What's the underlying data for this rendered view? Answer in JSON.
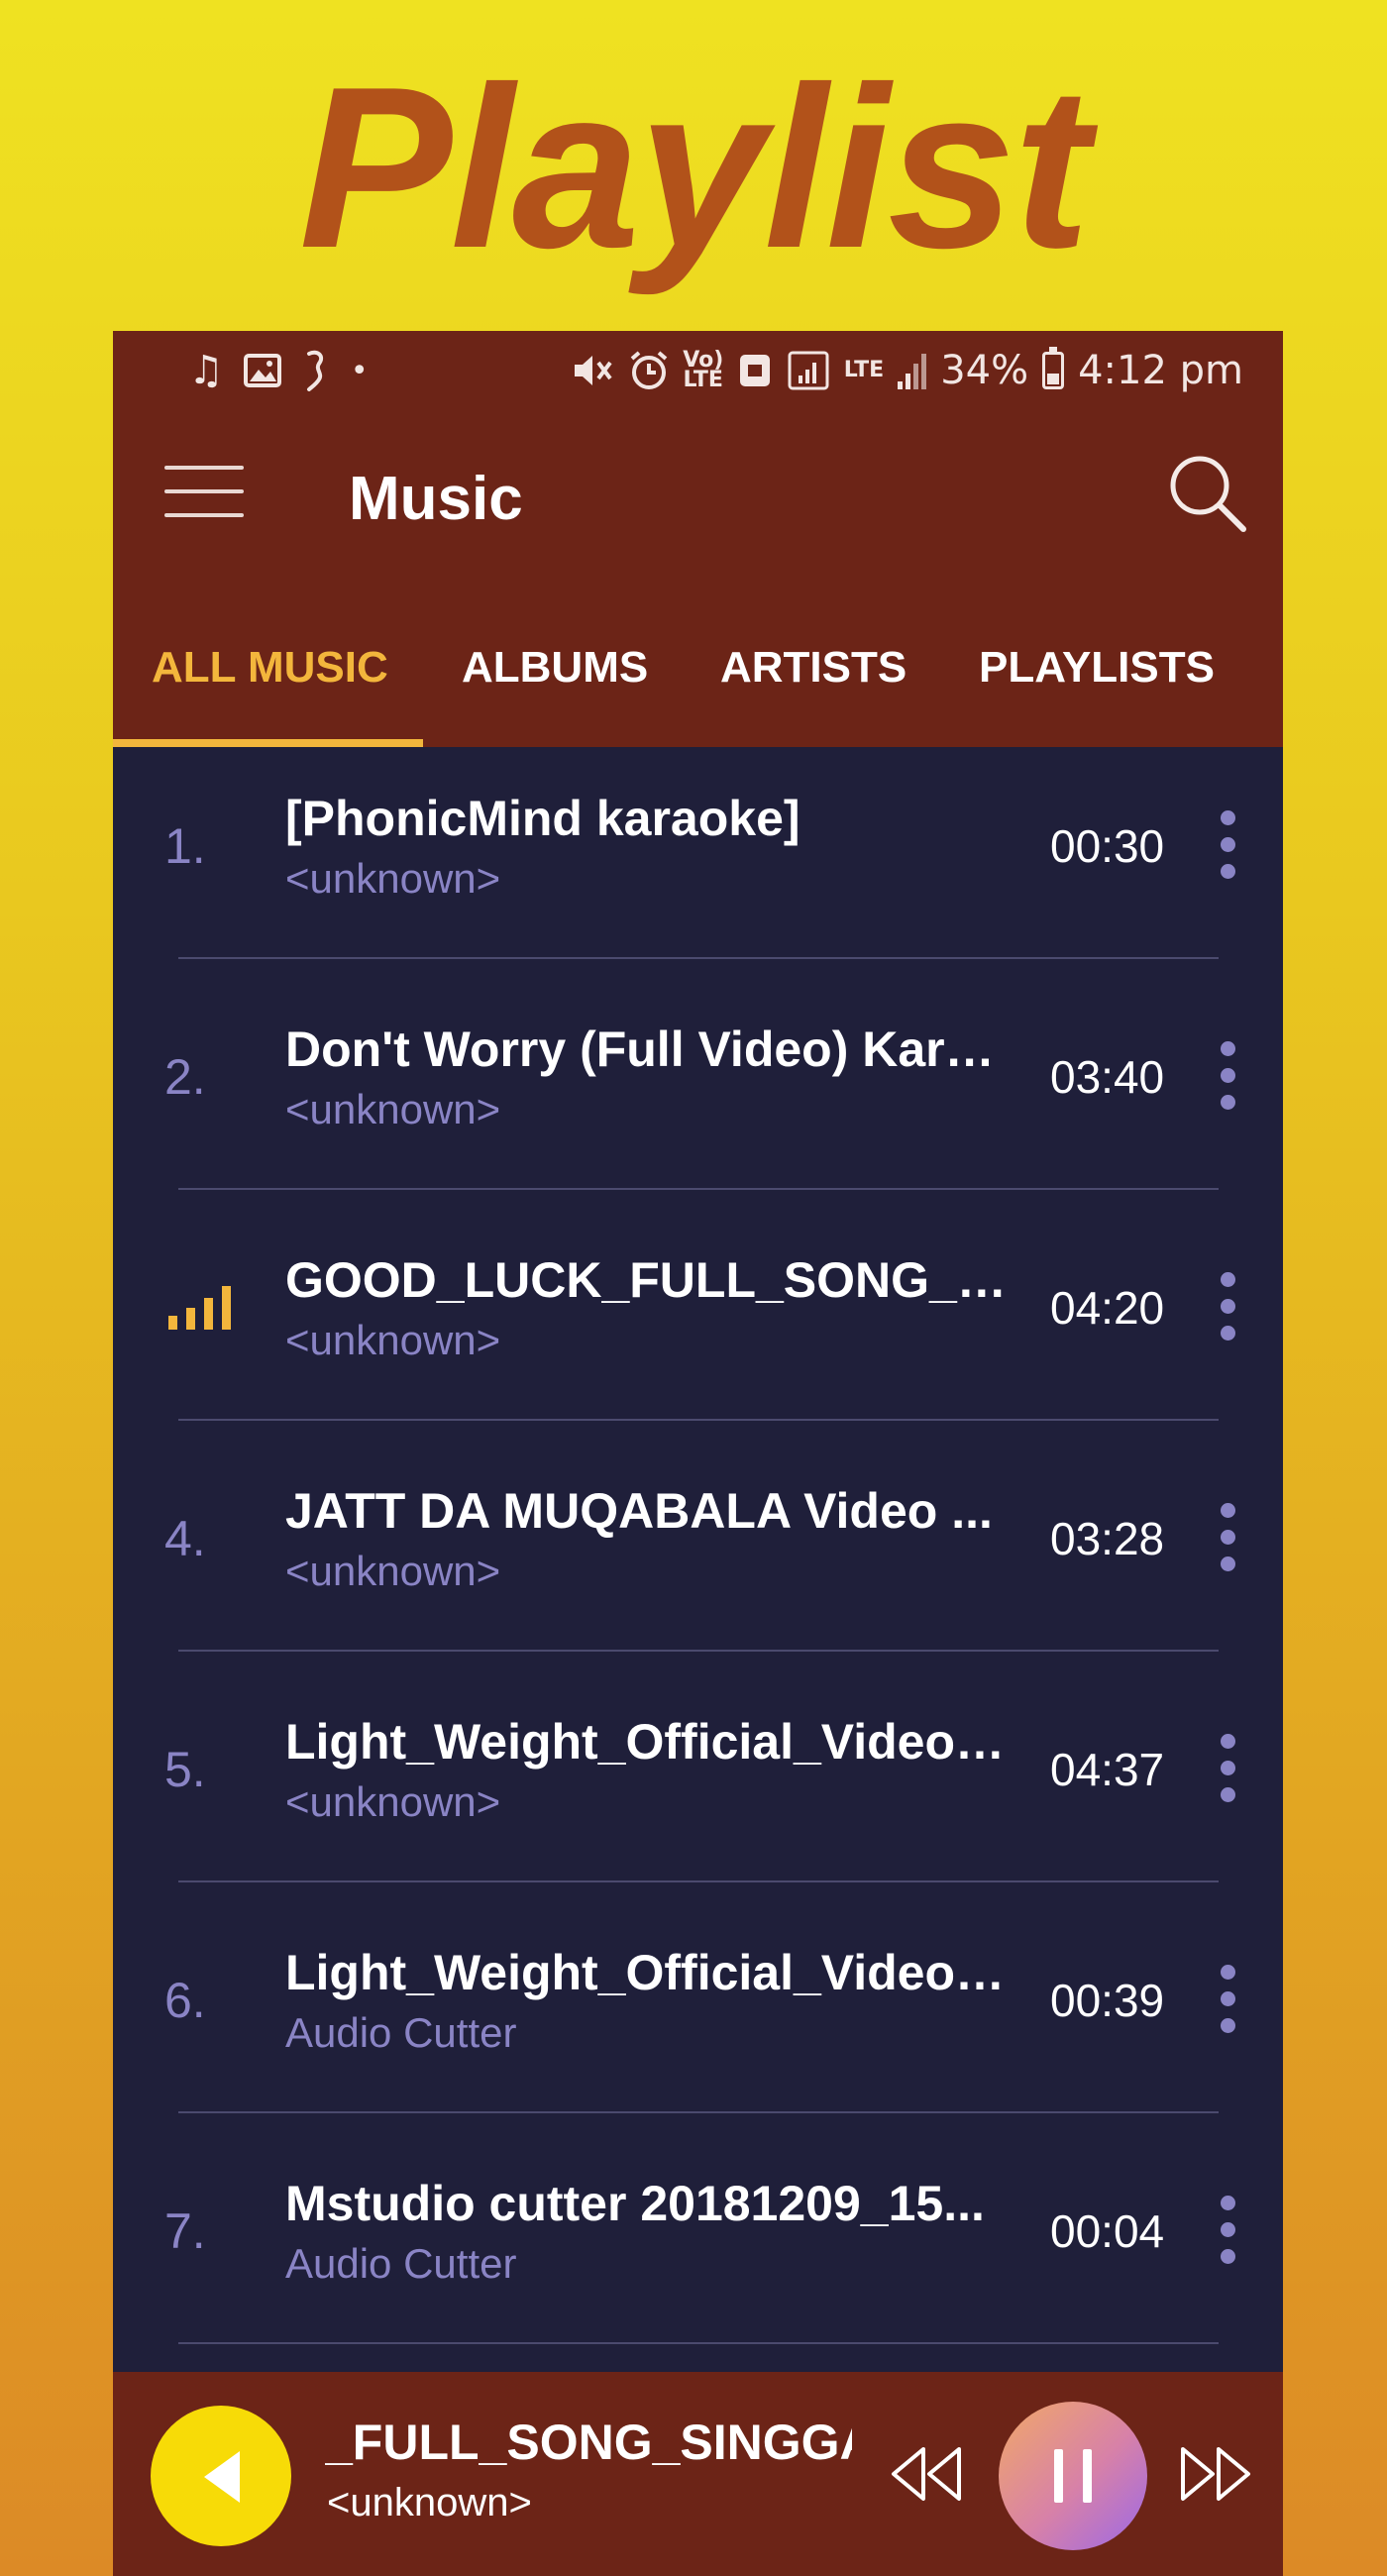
{
  "promo": {
    "title": "Playlist"
  },
  "status_bar": {
    "left_icons": [
      "music-note-icon",
      "image-icon",
      "gesture-icon",
      "dot-icon"
    ],
    "right_icons": [
      "vibrate-mute-icon",
      "alarm-icon",
      "volte-icon",
      "data-saver-icon",
      "wifi-calling-icon",
      "lte-signal-icon",
      "signal-icon",
      "battery-icon"
    ],
    "volte_label": "Vo) LTE",
    "lte_label": "LTE",
    "battery_percent": "34%",
    "time": "4:12 pm"
  },
  "appbar": {
    "title": "Music"
  },
  "tabs": [
    {
      "label": "ALL MUSIC",
      "active": true
    },
    {
      "label": "ALBUMS",
      "active": false
    },
    {
      "label": "ARTISTS",
      "active": false
    },
    {
      "label": "PLAYLISTS",
      "active": false
    }
  ],
  "songs": [
    {
      "index": "1.",
      "title": "[PhonicMind karaoke]",
      "artist": "<unknown>",
      "duration": "00:30",
      "playing": false
    },
    {
      "index": "2.",
      "title": "Don't Worry (Full Video) Kara...",
      "artist": "<unknown>",
      "duration": "03:40",
      "playing": false
    },
    {
      "index": "",
      "title": "GOOD_LUCK_FULL_SONG_SI...",
      "artist": "<unknown>",
      "duration": "04:20",
      "playing": true
    },
    {
      "index": "4.",
      "title": "JATT DA MUQABALA Video ...",
      "artist": "<unknown>",
      "duration": "03:28",
      "playing": false
    },
    {
      "index": "5.",
      "title": "Light_Weight_Official_Video_...",
      "artist": "<unknown>",
      "duration": "04:37",
      "playing": false
    },
    {
      "index": "6.",
      "title": "Light_Weight_Official_Video_...",
      "artist": "Audio Cutter",
      "duration": "00:39",
      "playing": false
    },
    {
      "index": "7.",
      "title": "Mstudio cutter 20181209_15...",
      "artist": "Audio Cutter",
      "duration": "00:04",
      "playing": false
    }
  ],
  "now_playing": {
    "title": "_FULL_SONG_SINGGA",
    "artist": "<unknown>",
    "controls": [
      "rewind-icon",
      "pause-icon",
      "fast-forward-icon"
    ]
  },
  "colors": {
    "appbar": "#6c2417",
    "list_bg": "#1f1f3a",
    "accent": "#f3b63c",
    "secondary_text": "#8a84c5",
    "promo_title": "#b2521a"
  }
}
